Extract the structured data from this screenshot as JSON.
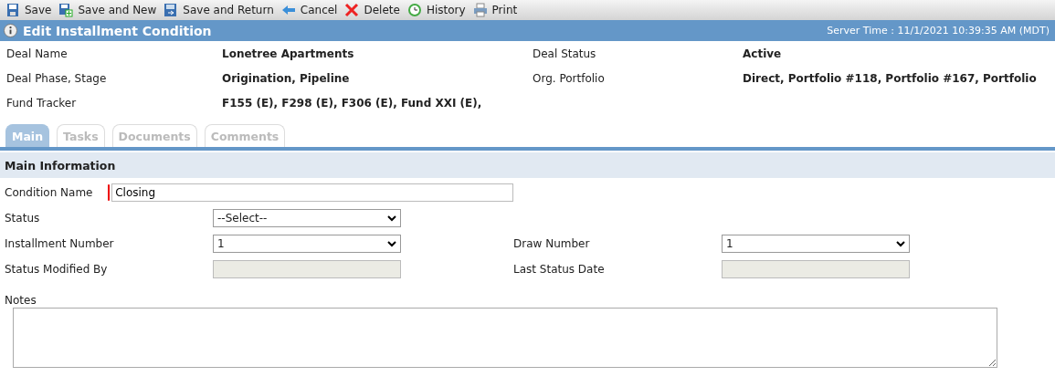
{
  "toolbar": [
    {
      "kind": "save",
      "label": "Save"
    },
    {
      "kind": "save-new",
      "label": "Save and New"
    },
    {
      "kind": "save-return",
      "label": "Save and Return"
    },
    {
      "kind": "cancel",
      "label": "Cancel"
    },
    {
      "kind": "delete",
      "label": "Delete"
    },
    {
      "kind": "history",
      "label": "History"
    },
    {
      "kind": "print",
      "label": "Print"
    }
  ],
  "title_bar": {
    "title": "Edit Installment Condition",
    "server_time": "Server Time : 11/1/2021 10:39:35 AM (MDT)"
  },
  "deal_info": [
    {
      "label": "Deal Name",
      "value": "Lonetree Apartments"
    },
    {
      "label": "Deal Status",
      "value": "Active"
    },
    {
      "label": "Deal Phase, Stage",
      "value": "Origination, Pipeline"
    },
    {
      "label": "Org. Portfolio",
      "value": "Direct, Portfolio #118, Portfolio #167, Portfolio"
    },
    {
      "label": "Fund Tracker",
      "value": "F155 (E), F298 (E), F306 (E), Fund XXI (E),"
    }
  ],
  "tabs": [
    {
      "label": "Main",
      "selected": true
    },
    {
      "label": "Tasks",
      "selected": false
    },
    {
      "label": "Documents",
      "selected": false
    },
    {
      "label": "Comments",
      "selected": false
    }
  ],
  "section": {
    "title": "Main Information"
  },
  "form_rows": [
    [
      {
        "label": "Condition Name",
        "kind": "text",
        "value": "Closing",
        "required": true
      }
    ],
    [
      {
        "label": "Status",
        "kind": "select",
        "value": "--Select--",
        "required": false
      }
    ],
    [
      {
        "label": "Installment Number",
        "kind": "select",
        "value": "1",
        "required": false
      },
      {
        "label": "Draw Number",
        "kind": "select",
        "value": "1"
      }
    ],
    [
      {
        "label": "Status Modified By",
        "kind": "readonly",
        "required": false
      },
      {
        "label": "Last Status Date",
        "kind": "readonly"
      }
    ]
  ],
  "notes": {
    "label": "Notes"
  }
}
